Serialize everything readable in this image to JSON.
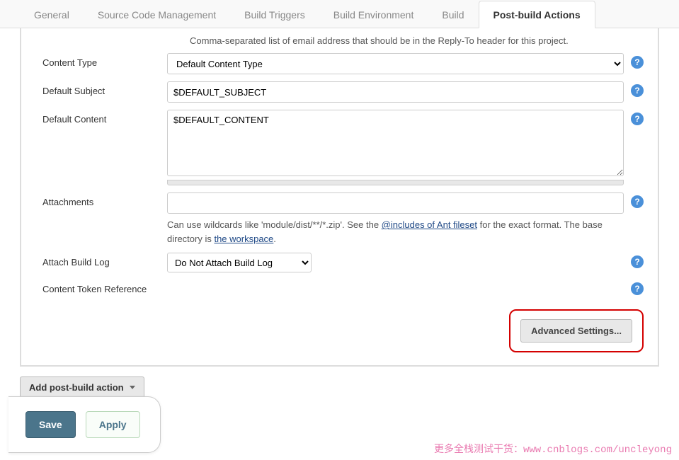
{
  "tabs": {
    "general": "General",
    "scm": "Source Code Management",
    "triggers": "Build Triggers",
    "env": "Build Environment",
    "build": "Build",
    "postbuild": "Post-build Actions"
  },
  "replyto_help": "Comma-separated list of email address that should be in the Reply-To header for this project.",
  "fields": {
    "content_type": {
      "label": "Content Type",
      "value": "Default Content Type"
    },
    "default_subject": {
      "label": "Default Subject",
      "value": "$DEFAULT_SUBJECT"
    },
    "default_content": {
      "label": "Default Content",
      "value": "$DEFAULT_CONTENT"
    },
    "attachments": {
      "label": "Attachments",
      "value": "",
      "desc_pre": "Can use wildcards like 'module/dist/**/*.zip'. See the ",
      "desc_link1": "@includes of Ant fileset",
      "desc_mid": " for the exact format. The base directory is ",
      "desc_link2": "the workspace",
      "desc_suf": "."
    },
    "attach_build_log": {
      "label": "Attach Build Log",
      "value": "Do Not Attach Build Log"
    },
    "token_ref": {
      "label": "Content Token Reference"
    }
  },
  "buttons": {
    "advanced": "Advanced Settings...",
    "add_action": "Add post-build action",
    "save": "Save",
    "apply": "Apply"
  },
  "watermark": {
    "text": "更多全栈测试干货：",
    "link": "www.cnblogs.com/uncleyong"
  }
}
